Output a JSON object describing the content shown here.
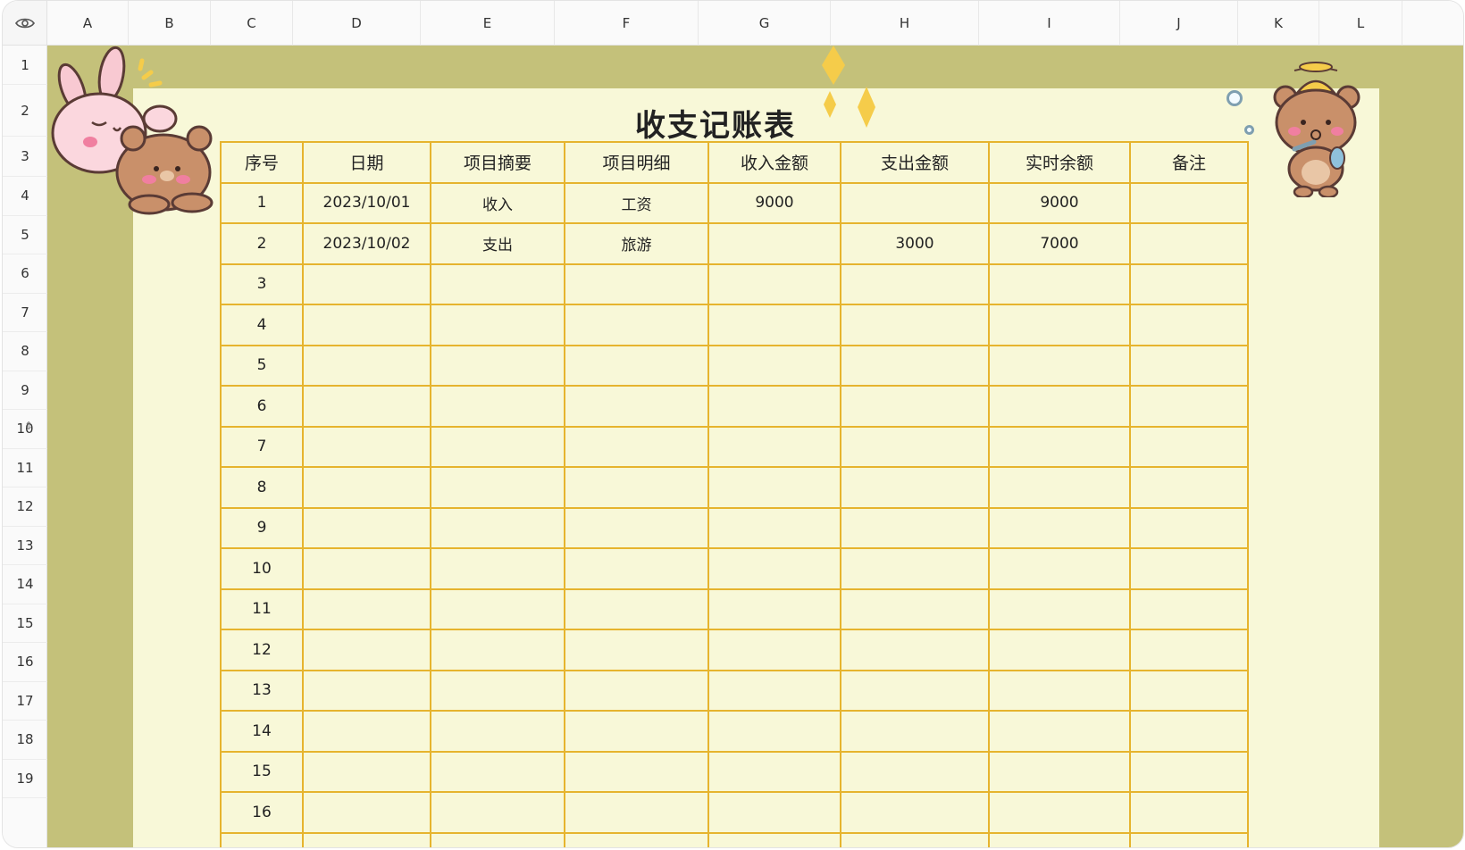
{
  "columns": [
    "A",
    "B",
    "C",
    "D",
    "E",
    "F",
    "G",
    "H",
    "I",
    "J",
    "K",
    "L"
  ],
  "rows": [
    "1",
    "2",
    "3",
    "4",
    "5",
    "6",
    "7",
    "8",
    "9",
    "10",
    "11",
    "12",
    "13",
    "14",
    "15",
    "16",
    "17",
    "18",
    "19"
  ],
  "corner_icon": "eye-icon",
  "title": "收支记账表",
  "table": {
    "headers": [
      "序号",
      "日期",
      "项目摘要",
      "项目明细",
      "收入金额",
      "支出金额",
      "实时余额",
      "备注"
    ],
    "rows": [
      [
        "1",
        "2023/10/01",
        "收入",
        "工资",
        "9000",
        "",
        "9000",
        ""
      ],
      [
        "2",
        "2023/10/02",
        "支出",
        "旅游",
        "",
        "3000",
        "7000",
        ""
      ],
      [
        "3",
        "",
        "",
        "",
        "",
        "",
        "",
        ""
      ],
      [
        "4",
        "",
        "",
        "",
        "",
        "",
        "",
        ""
      ],
      [
        "5",
        "",
        "",
        "",
        "",
        "",
        "",
        ""
      ],
      [
        "6",
        "",
        "",
        "",
        "",
        "",
        "",
        ""
      ],
      [
        "7",
        "",
        "",
        "",
        "",
        "",
        "",
        ""
      ],
      [
        "8",
        "",
        "",
        "",
        "",
        "",
        "",
        ""
      ],
      [
        "9",
        "",
        "",
        "",
        "",
        "",
        "",
        ""
      ],
      [
        "10",
        "",
        "",
        "",
        "",
        "",
        "",
        ""
      ],
      [
        "11",
        "",
        "",
        "",
        "",
        "",
        "",
        ""
      ],
      [
        "12",
        "",
        "",
        "",
        "",
        "",
        "",
        ""
      ],
      [
        "13",
        "",
        "",
        "",
        "",
        "",
        "",
        ""
      ],
      [
        "14",
        "",
        "",
        "",
        "",
        "",
        "",
        ""
      ],
      [
        "15",
        "",
        "",
        "",
        "",
        "",
        "",
        ""
      ],
      [
        "16",
        "",
        "",
        "",
        "",
        "",
        "",
        ""
      ],
      [
        "",
        "",
        "",
        "",
        "",
        "",
        "",
        ""
      ]
    ]
  },
  "colors": {
    "sheet_background": "#c4c17a",
    "paper": "#f8f8d8",
    "table_border": "#e6b42e",
    "sparkle": "#f5cc4a"
  }
}
